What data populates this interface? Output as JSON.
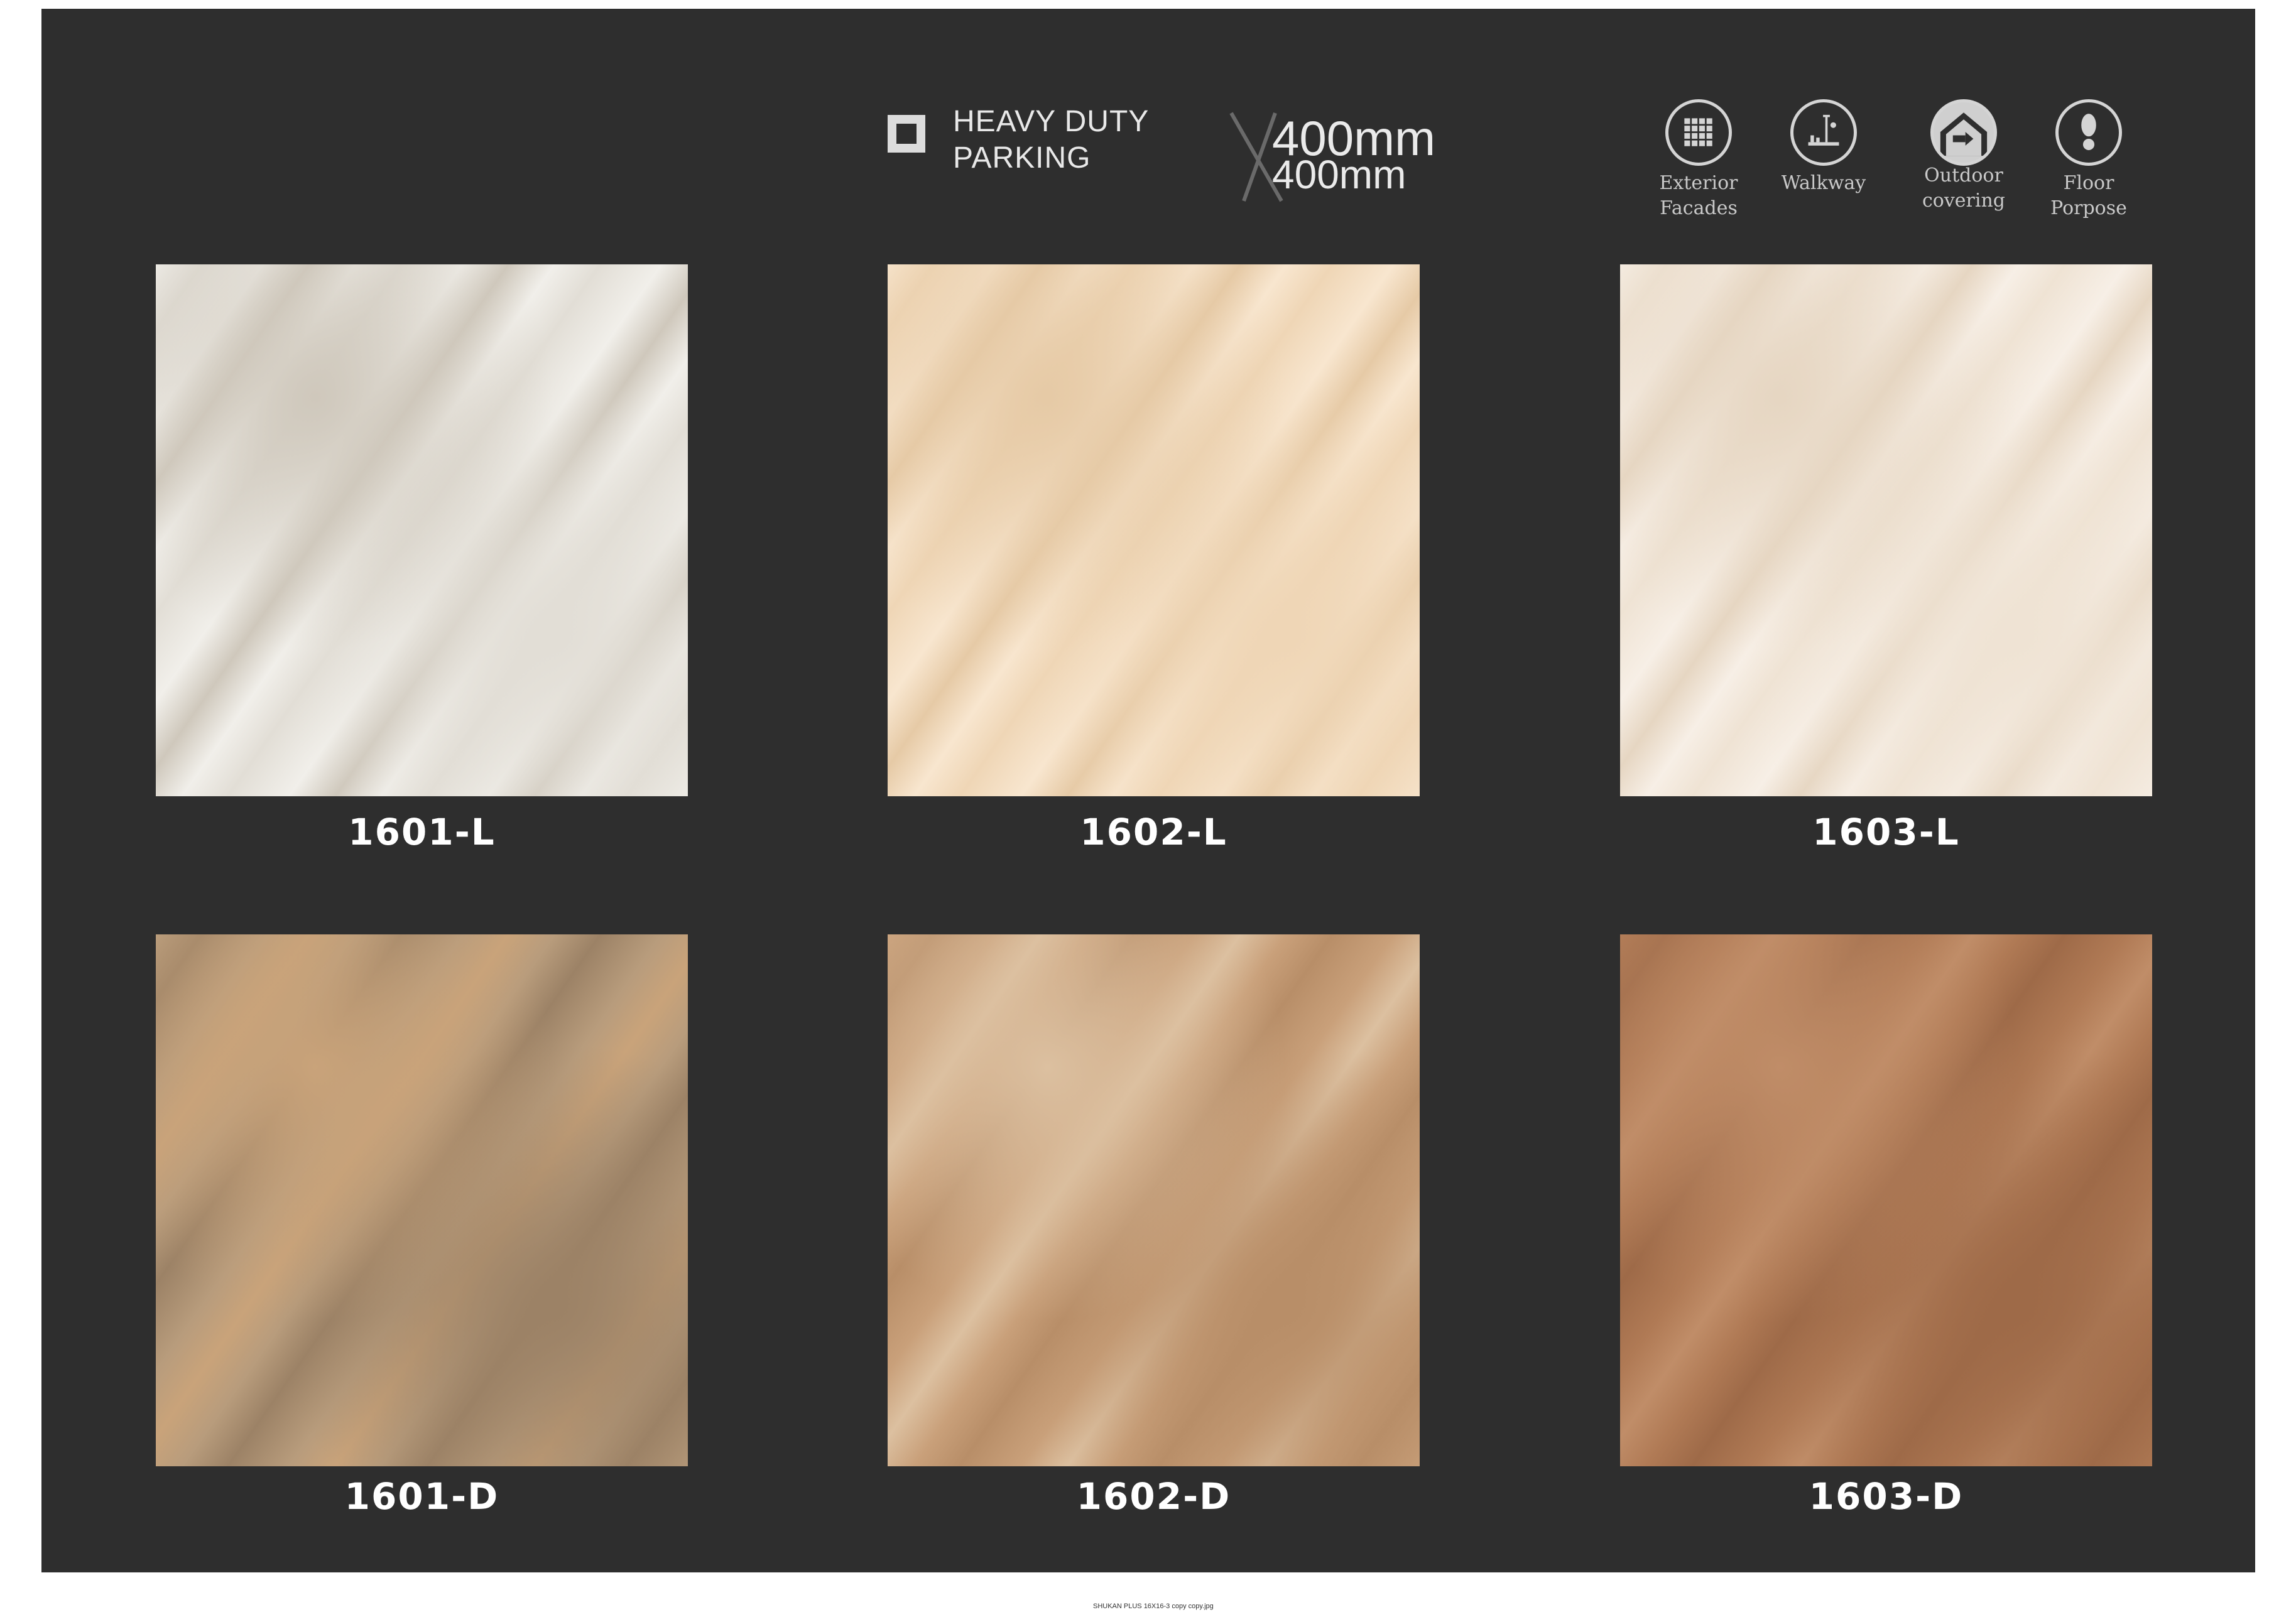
{
  "header": {
    "feature_line1": "HEAVY DUTY",
    "feature_line2": "PARKING",
    "size_line1": "400mm",
    "size_line2": "400mm"
  },
  "usage": [
    {
      "label": "Exterior\nFacades",
      "icon": "grid-icon"
    },
    {
      "label": "Walkway",
      "icon": "walkway-icon"
    },
    {
      "label": "Outdoor\ncovering",
      "icon": "outdoor-covering-icon"
    },
    {
      "label": "Floor\nPorpose",
      "icon": "footprint-icon"
    }
  ],
  "tiles": [
    {
      "code": "1601-L",
      "colors": [
        "#f1efea",
        "#e2ded6",
        "#cfc8bc"
      ]
    },
    {
      "code": "1602-L",
      "colors": [
        "#f8e6cf",
        "#efd6b6",
        "#e6caa6"
      ]
    },
    {
      "code": "1603-L",
      "colors": [
        "#f7efe6",
        "#efe3d4",
        "#e6d6c2"
      ]
    },
    {
      "code": "1601-D",
      "colors": [
        "#b89c7c",
        "#9c8266",
        "#c9a37a"
      ]
    },
    {
      "code": "1602-D",
      "colors": [
        "#c9a07a",
        "#b88e68",
        "#dcc0a0"
      ]
    },
    {
      "code": "1603-D",
      "colors": [
        "#b07a55",
        "#9e6a48",
        "#c08d68"
      ]
    }
  ],
  "footer": {
    "filename": "SHUKAN PLUS 16X16-3 copy copy.jpg"
  }
}
